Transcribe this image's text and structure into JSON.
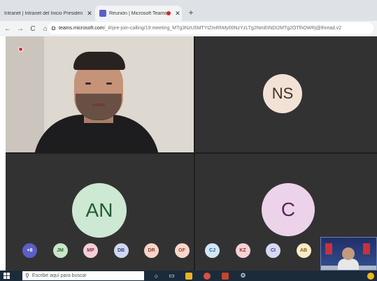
{
  "browser": {
    "tabs": [
      {
        "label": "Intranet | Intranet del Inicio Presiden",
        "close": "✕"
      },
      {
        "label": "Reunión | Microsoft Teams",
        "close": "✕"
      }
    ],
    "new_tab": "+",
    "nav": {
      "back": "←",
      "forward": "→",
      "reload": "C",
      "home": "⌂"
    },
    "url_host": "teams.microsoft.com",
    "url_path": "/_#/pre-join-calling/19:meeting_MTg3NzU5MTYtZmRhMy00NzYzLTg2NmEtNDI2MTg2OTlhOWRj@thread.v2"
  },
  "meeting": {
    "tiles": [
      {
        "initials": "NS"
      },
      {
        "initials": "AN"
      },
      {
        "initials": "C"
      }
    ],
    "participants": [
      {
        "initials": "+8",
        "bg": "#5b5fc7",
        "fg": "#ffffff"
      },
      {
        "initials": "JM",
        "bg": "#c8e6c9",
        "fg": "#2e6b34"
      },
      {
        "initials": "MP",
        "bg": "#f3d0d8",
        "fg": "#8b2f45"
      },
      {
        "initials": "DB",
        "bg": "#cfd8f0",
        "fg": "#2d4288"
      },
      {
        "initials": "DR",
        "bg": "#f6d6c8",
        "fg": "#8c4126"
      },
      {
        "initials": "OF",
        "bg": "#f7d8cc",
        "fg": "#a14824"
      },
      {
        "initials": "CJ",
        "bg": "#d3e7f5",
        "fg": "#1f5c8a"
      },
      {
        "initials": "KZ",
        "bg": "#f4d3d6",
        "fg": "#8d2d36"
      },
      {
        "initials": "CI",
        "bg": "#d6d9f2",
        "fg": "#34408f"
      },
      {
        "initials": "AB",
        "bg": "#f6ecc7",
        "fg": "#7a6418"
      }
    ]
  },
  "taskbar": {
    "search_placeholder": "Escribe aquí para buscar",
    "icons": [
      "cortana-icon",
      "task-view-icon",
      "file-explorer-icon",
      "chrome-icon",
      "powerpoint-icon",
      "settings-icon"
    ]
  }
}
